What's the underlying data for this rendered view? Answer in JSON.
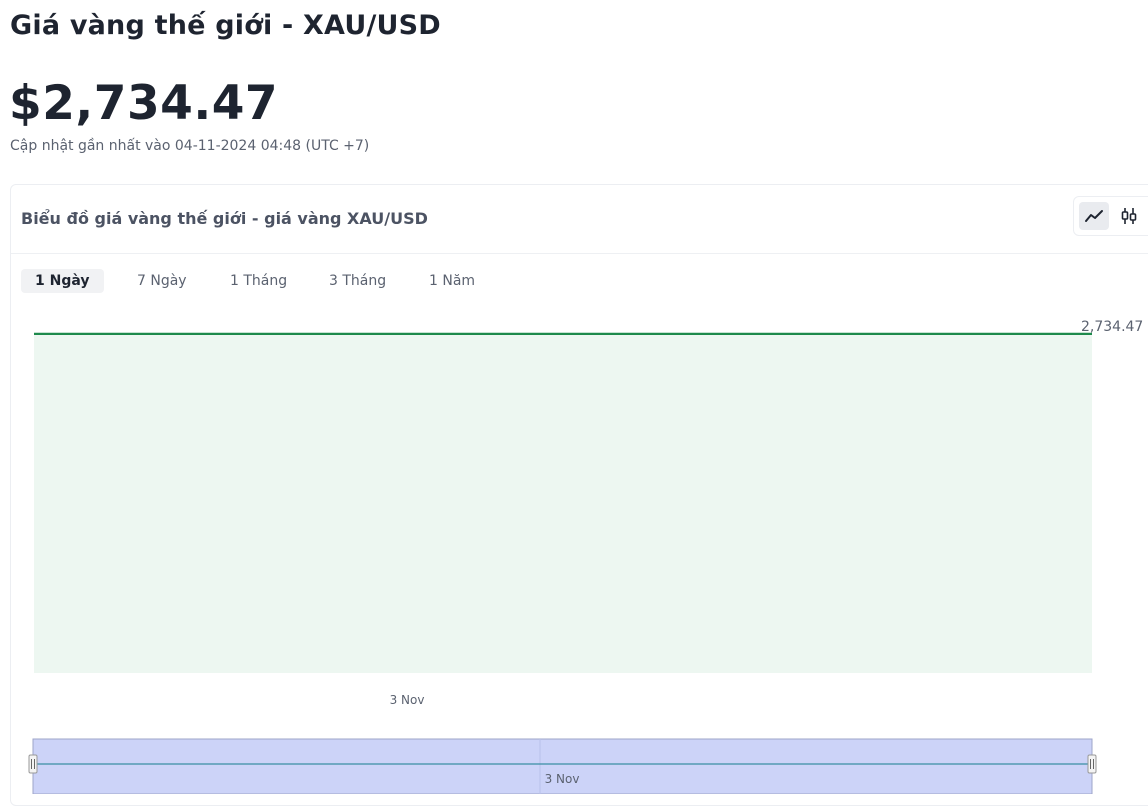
{
  "header": {
    "title": "Giá vàng thế giới - XAU/USD",
    "price": "$2,734.47",
    "updated": "Cập nhật gần nhất vào 04-11-2024 04:48 (UTC +7)"
  },
  "card": {
    "title": "Biểu đồ giá vàng thế giới - giá vàng XAU/USD",
    "chart_types": [
      {
        "icon": "line-chart-icon",
        "active": true
      },
      {
        "icon": "candlestick-icon",
        "active": false
      }
    ],
    "tabs": [
      {
        "label": "1 Ngày",
        "active": true
      },
      {
        "label": "7 Ngày",
        "active": false
      },
      {
        "label": "1 Tháng",
        "active": false
      },
      {
        "label": "3 Tháng",
        "active": false
      },
      {
        "label": "1 Năm",
        "active": false
      }
    ]
  },
  "colors": {
    "line": "#1e8a4c",
    "fill": "#edf7f1",
    "navigator_fill": "#ccd3f8",
    "navigator_border": "#9ea5c9",
    "navigator_line": "#3a8fa3"
  },
  "chart_data": {
    "type": "area",
    "x": [
      "3 Nov",
      "3 Nov"
    ],
    "y": [
      2734.47,
      2734.47
    ],
    "last_value_label": "2,734.47",
    "x_tick_labels": [
      "3 Nov"
    ],
    "navigator_label": "3 Nov",
    "grid": false
  }
}
